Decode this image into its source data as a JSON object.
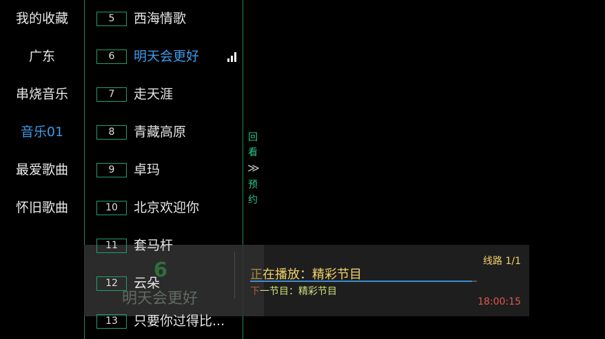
{
  "categories": [
    {
      "label": "我的收藏",
      "active": false
    },
    {
      "label": "广东",
      "active": false
    },
    {
      "label": "串烧音乐",
      "active": false
    },
    {
      "label": "音乐01",
      "active": true
    },
    {
      "label": "最爱歌曲",
      "active": false
    },
    {
      "label": "怀旧歌曲",
      "active": false
    }
  ],
  "channels": [
    {
      "num": "5",
      "name": "西海情歌"
    },
    {
      "num": "6",
      "name": "明天会更好",
      "active": true
    },
    {
      "num": "7",
      "name": "走天涯"
    },
    {
      "num": "8",
      "name": "青藏高原"
    },
    {
      "num": "9",
      "name": "卓玛"
    },
    {
      "num": "10",
      "name": "北京欢迎你"
    },
    {
      "num": "11",
      "name": "套马杆"
    },
    {
      "num": "12",
      "name": "云朵"
    },
    {
      "num": "13",
      "name": "只要你过得比..."
    }
  ],
  "side_tab": {
    "top1": "回",
    "top2": "看",
    "arrow": "≫",
    "bot1": "预",
    "bot2": "约"
  },
  "info": {
    "channel_num": "6",
    "channel_name": "明天会更好",
    "now_prefix": "正",
    "now_label": "在播放：精彩节目",
    "next_prefix": "下",
    "next_label": "一节目：精彩节目",
    "line": "线路 1/1",
    "time": "18:00:15",
    "progress": 0.98
  },
  "colors": {
    "accent": "#3d9be8",
    "border": "#22a06e",
    "now": "#f2d36a",
    "time": "#e0584a"
  }
}
